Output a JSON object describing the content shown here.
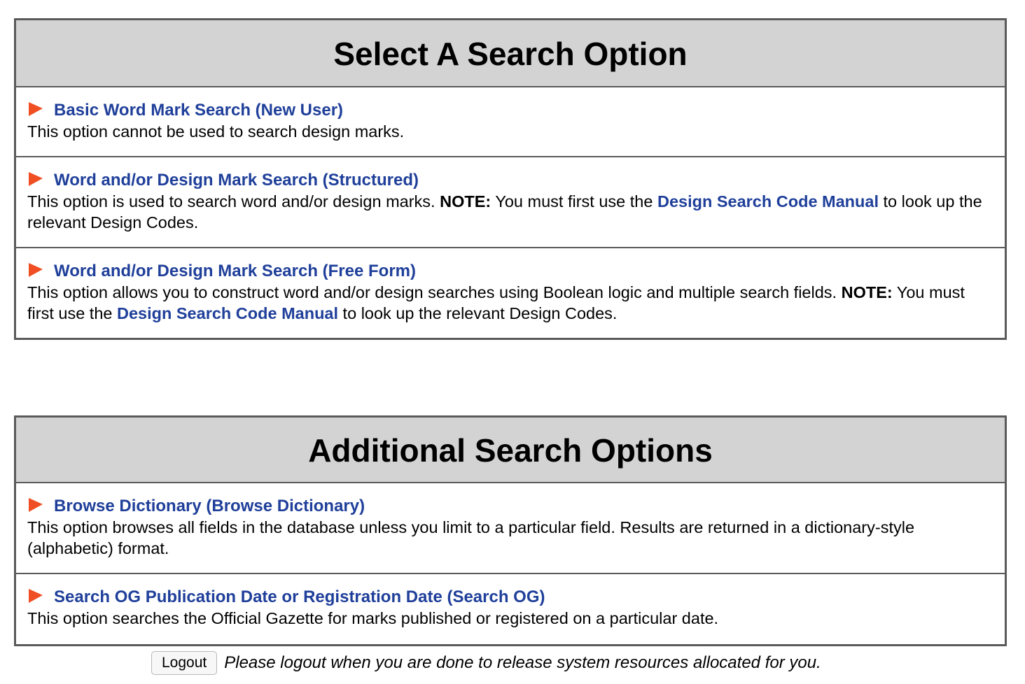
{
  "main_panel": {
    "title": "Select A Search Option",
    "options": [
      {
        "link": "Basic Word Mark Search (New User)",
        "desc": "This option cannot be used to search design marks."
      },
      {
        "link": "Word and/or Design Mark Search (Structured)",
        "desc_before": "This option is used to search word and/or design marks. ",
        "note_label": "NOTE:",
        "desc_mid": " You must first use the ",
        "manual_link": "Design Search Code Manual",
        "desc_after": " to look up the relevant Design Codes."
      },
      {
        "link": "Word and/or Design Mark Search (Free Form)",
        "desc_before": "This option allows you to construct word and/or design searches using Boolean logic and multiple search fields. ",
        "note_label": "NOTE:",
        "desc_mid": " You must first use the ",
        "manual_link": "Design Search Code Manual",
        "desc_after": " to look up the relevant Design Codes."
      }
    ]
  },
  "additional_panel": {
    "title": "Additional Search Options",
    "options": [
      {
        "link": "Browse Dictionary (Browse Dictionary)",
        "desc": "This option browses all fields in the database unless you limit to a particular field. Results are returned in a dictionary-style (alphabetic) format."
      },
      {
        "link": "Search OG Publication Date or Registration Date (Search OG)",
        "desc": "This option searches the Official Gazette for marks published or registered on a particular date."
      }
    ]
  },
  "footer": {
    "logout_label": "Logout",
    "message": "Please logout when you are done to release system resources allocated for you."
  },
  "colors": {
    "link": "#1f3f9a",
    "flag": "#f04e23",
    "header_bg": "#d3d3d3",
    "border": "#5a5a5a"
  },
  "icons": {
    "option_marker": "orange-flag-icon"
  }
}
